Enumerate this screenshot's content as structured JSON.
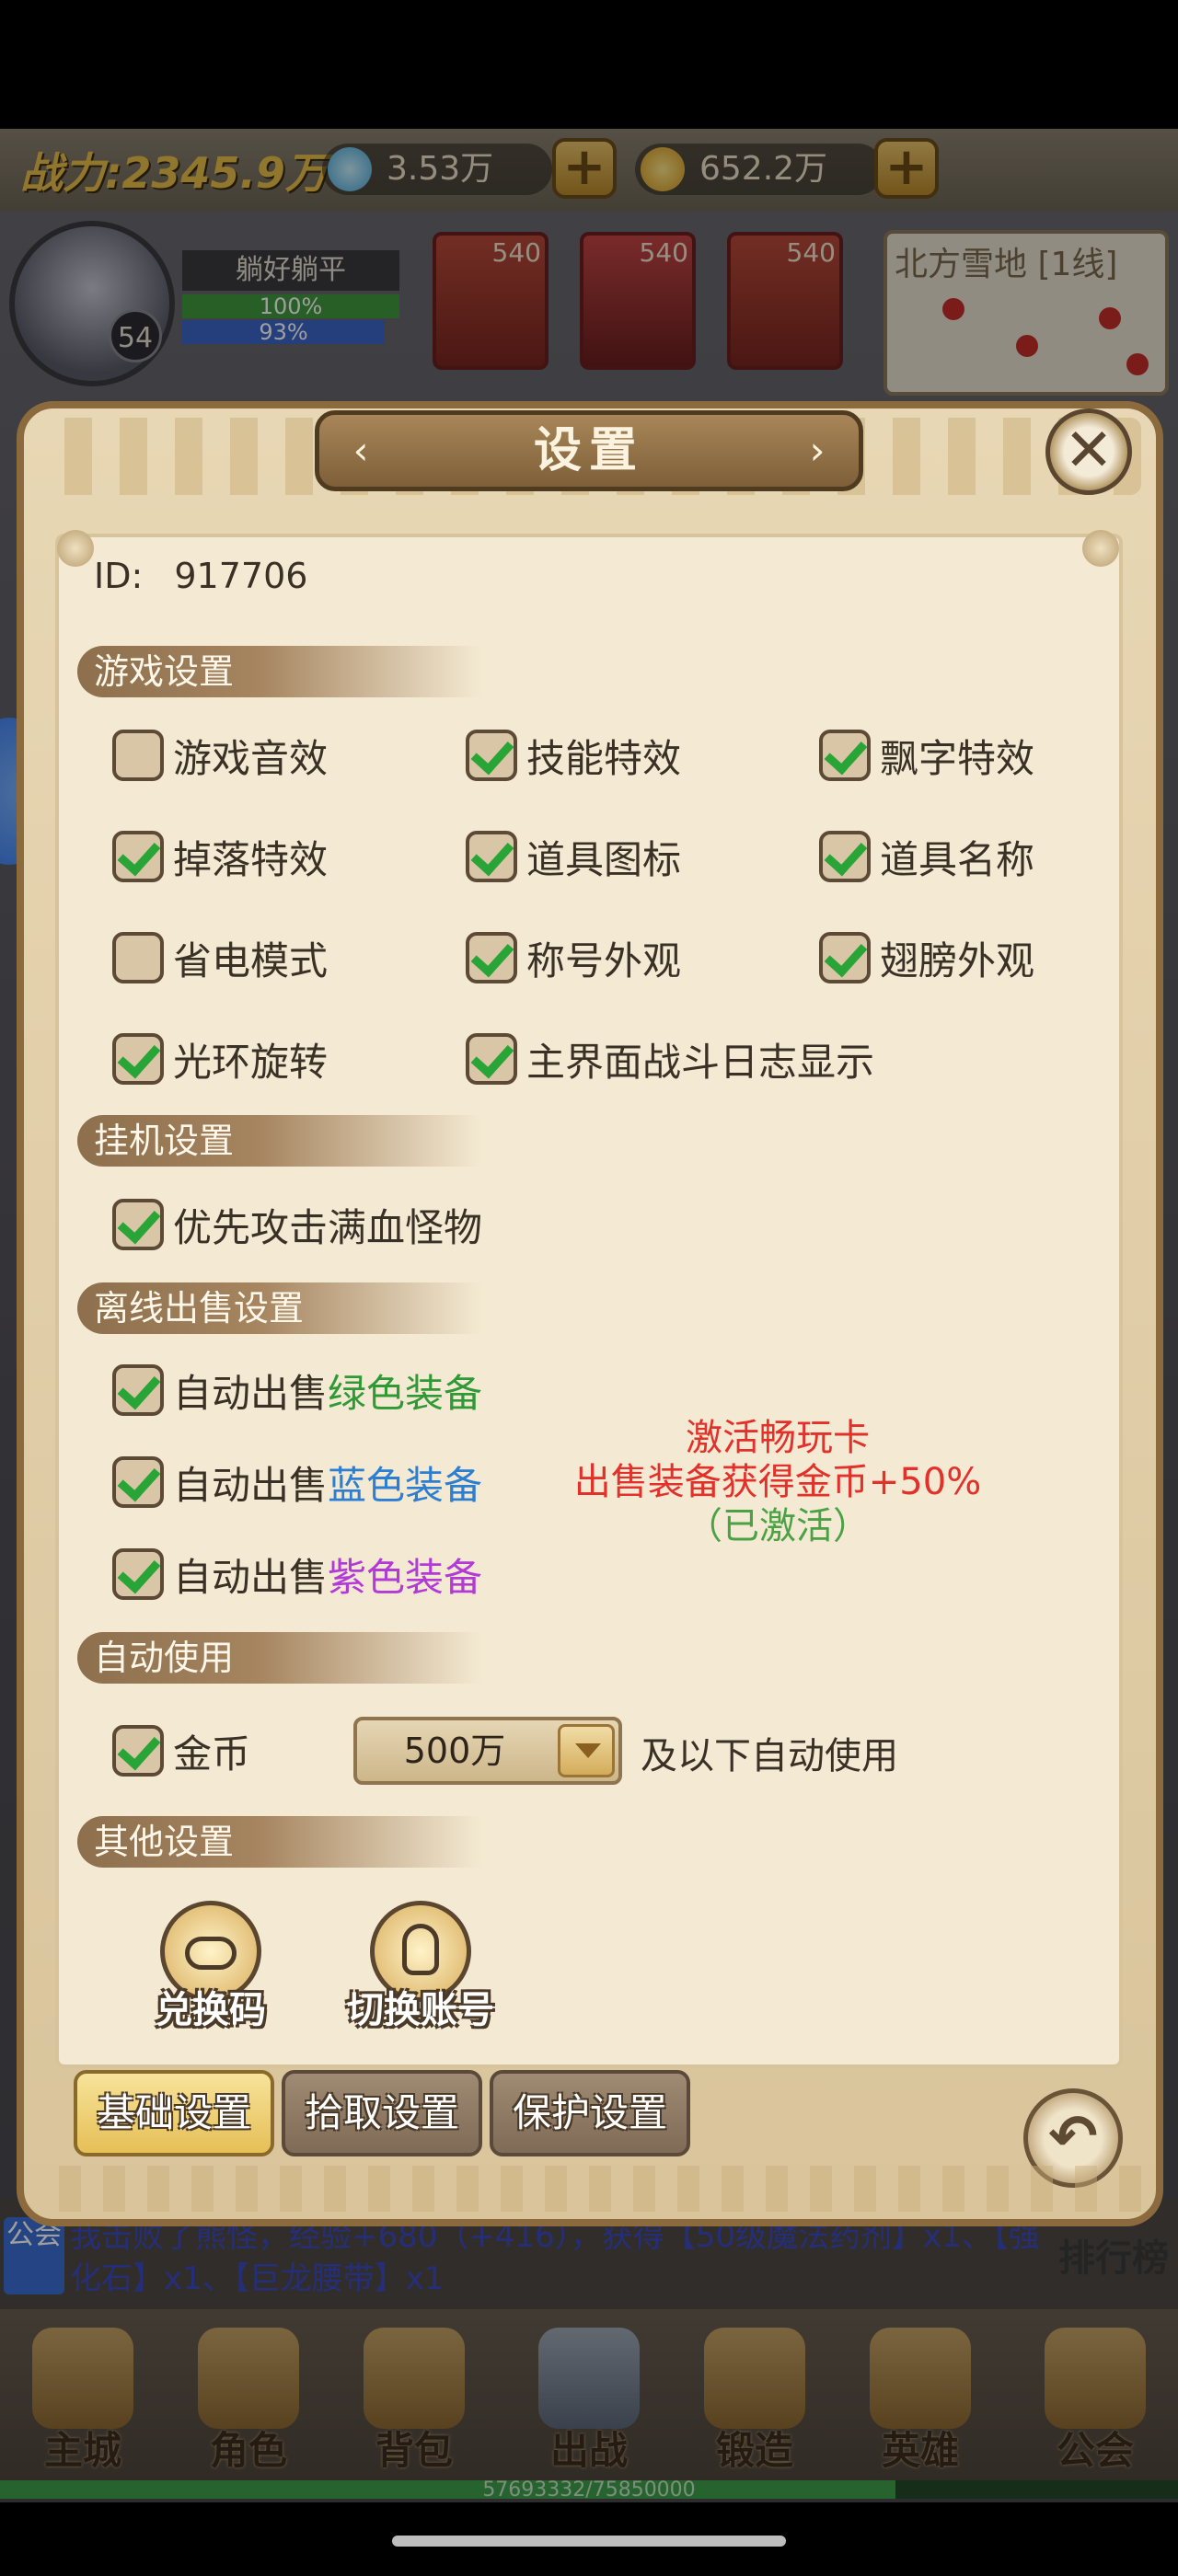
{
  "topbar": {
    "power": "战力:2345.9万",
    "diamonds": "3.53万",
    "gold": "652.2万",
    "plus": "+"
  },
  "player": {
    "level": "54",
    "name": "躺好躺平",
    "hp": "100%",
    "mp": "93%"
  },
  "heroes": [
    {
      "level": "540"
    },
    {
      "level": "540"
    },
    {
      "level": "540"
    }
  ],
  "map": {
    "title": "北方雪地 [1线]"
  },
  "dialog": {
    "title": "设置",
    "close": "✕",
    "id_label": "ID:",
    "id_value": "917706",
    "sections": {
      "game": "游戏设置",
      "idle": "挂机设置",
      "offline_sell": "离线出售设置",
      "auto_use": "自动使用",
      "other": "其他设置"
    },
    "game_options": [
      {
        "label": "游戏音效",
        "checked": false
      },
      {
        "label": "技能特效",
        "checked": true
      },
      {
        "label": "飘字特效",
        "checked": true
      },
      {
        "label": "掉落特效",
        "checked": true
      },
      {
        "label": "道具图标",
        "checked": true
      },
      {
        "label": "道具名称",
        "checked": true
      },
      {
        "label": "省电模式",
        "checked": false
      },
      {
        "label": "称号外观",
        "checked": true
      },
      {
        "label": "翅膀外观",
        "checked": true
      },
      {
        "label": "光环旋转",
        "checked": true
      },
      {
        "label": "主界面战斗日志显示",
        "checked": true
      }
    ],
    "idle_options": [
      {
        "label": "优先攻击满血怪物",
        "checked": true
      }
    ],
    "sell_options": [
      {
        "prefix": "自动出售",
        "color_text": "绿色装备",
        "color": "green",
        "checked": true
      },
      {
        "prefix": "自动出售",
        "color_text": "蓝色装备",
        "color": "blue",
        "checked": true
      },
      {
        "prefix": "自动出售",
        "color_text": "紫色装备",
        "color": "purple",
        "checked": true
      }
    ],
    "promo": {
      "line1": "激活畅玩卡",
      "line2": "出售装备获得金币+50%",
      "line3": "（已激活）"
    },
    "auto_use": {
      "label": "金币",
      "checked": true,
      "amount": "500万",
      "suffix": "及以下自动使用"
    },
    "other_buttons": [
      {
        "label": "兑换码",
        "icon": "gamepad-icon"
      },
      {
        "label": "切换账号",
        "icon": "switch-account-icon"
      }
    ],
    "tabs": [
      {
        "label": "基础设置",
        "active": true
      },
      {
        "label": "拾取设置",
        "active": false
      },
      {
        "label": "保护设置",
        "active": false
      }
    ],
    "back": "↶"
  },
  "chat": {
    "tag": "公会",
    "text": "我击败了熊怪，经验+680（+416），获得【50级魔法药剂】x1、【强化石】x1、【巨龙腰带】x1",
    "rank": "排行榜"
  },
  "nav": [
    {
      "label": "主城"
    },
    {
      "label": "角色"
    },
    {
      "label": "背包"
    },
    {
      "label": "出战"
    },
    {
      "label": "锻造"
    },
    {
      "label": "英雄"
    },
    {
      "label": "公会"
    }
  ],
  "exp": {
    "text": "57693332/75850000",
    "progress": 0.76
  },
  "colors": {
    "check_green": "#29a437",
    "gold_accent": "#e8c04a",
    "promo_red": "#e2312a"
  }
}
